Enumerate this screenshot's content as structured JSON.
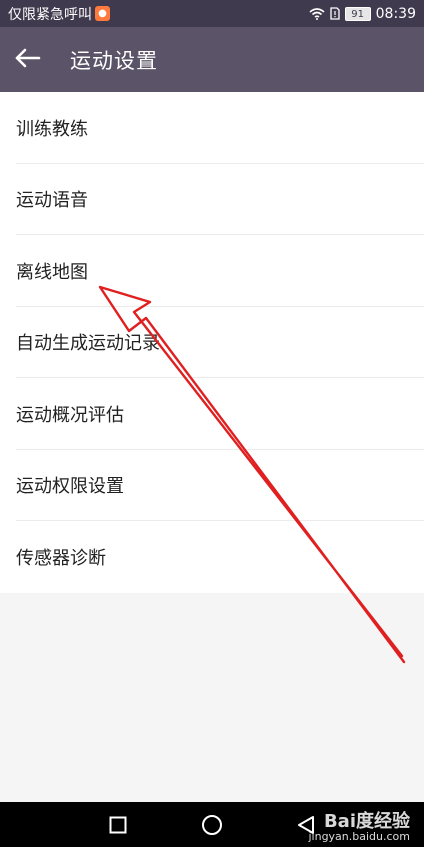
{
  "status_bar": {
    "left_text": "仅限紧急呼叫",
    "battery": "91",
    "time": "08:39"
  },
  "app_bar": {
    "title": "运动设置",
    "back_icon": "arrow-left-icon"
  },
  "menu": {
    "items": [
      {
        "label": "训练教练"
      },
      {
        "label": "运动语音"
      },
      {
        "label": "离线地图"
      },
      {
        "label": "自动生成运动记录"
      },
      {
        "label": "运动概况评估"
      },
      {
        "label": "运动权限设置"
      },
      {
        "label": "传感器诊断"
      }
    ]
  },
  "watermark": {
    "main": "Bai度经验",
    "sub": "jingyan.baidu.com"
  },
  "colors": {
    "status_bar": "#3f3a4d",
    "app_bar": "#5b5367",
    "annotation_arrow": "#e02020"
  }
}
